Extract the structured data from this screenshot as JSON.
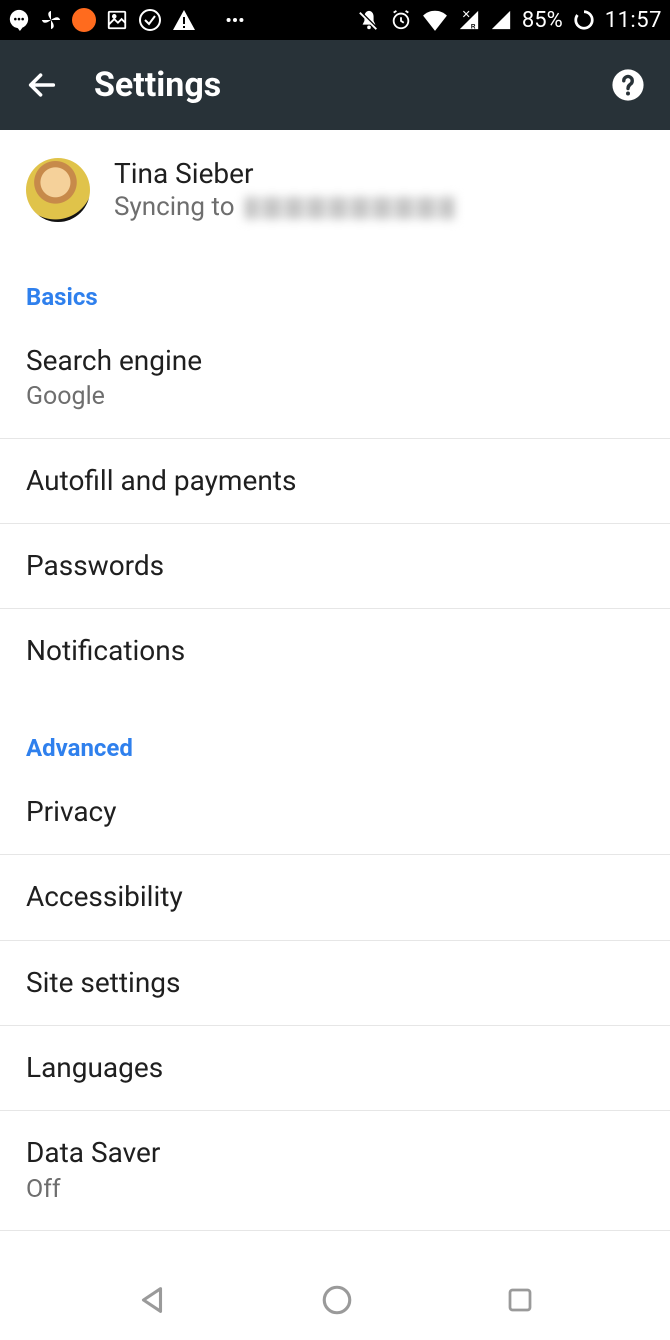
{
  "statusbar": {
    "battery": "85%",
    "time": "11:57"
  },
  "appbar": {
    "title": "Settings"
  },
  "account": {
    "name": "Tina Sieber",
    "sync_prefix": "Syncing to"
  },
  "sections": [
    {
      "header": "Basics",
      "items": [
        {
          "title": "Search engine",
          "subtitle": "Google"
        },
        {
          "title": "Autofill and payments"
        },
        {
          "title": "Passwords"
        },
        {
          "title": "Notifications"
        }
      ]
    },
    {
      "header": "Advanced",
      "items": [
        {
          "title": "Privacy"
        },
        {
          "title": "Accessibility"
        },
        {
          "title": "Site settings"
        },
        {
          "title": "Languages"
        },
        {
          "title": "Data Saver",
          "subtitle": "Off"
        }
      ]
    }
  ]
}
